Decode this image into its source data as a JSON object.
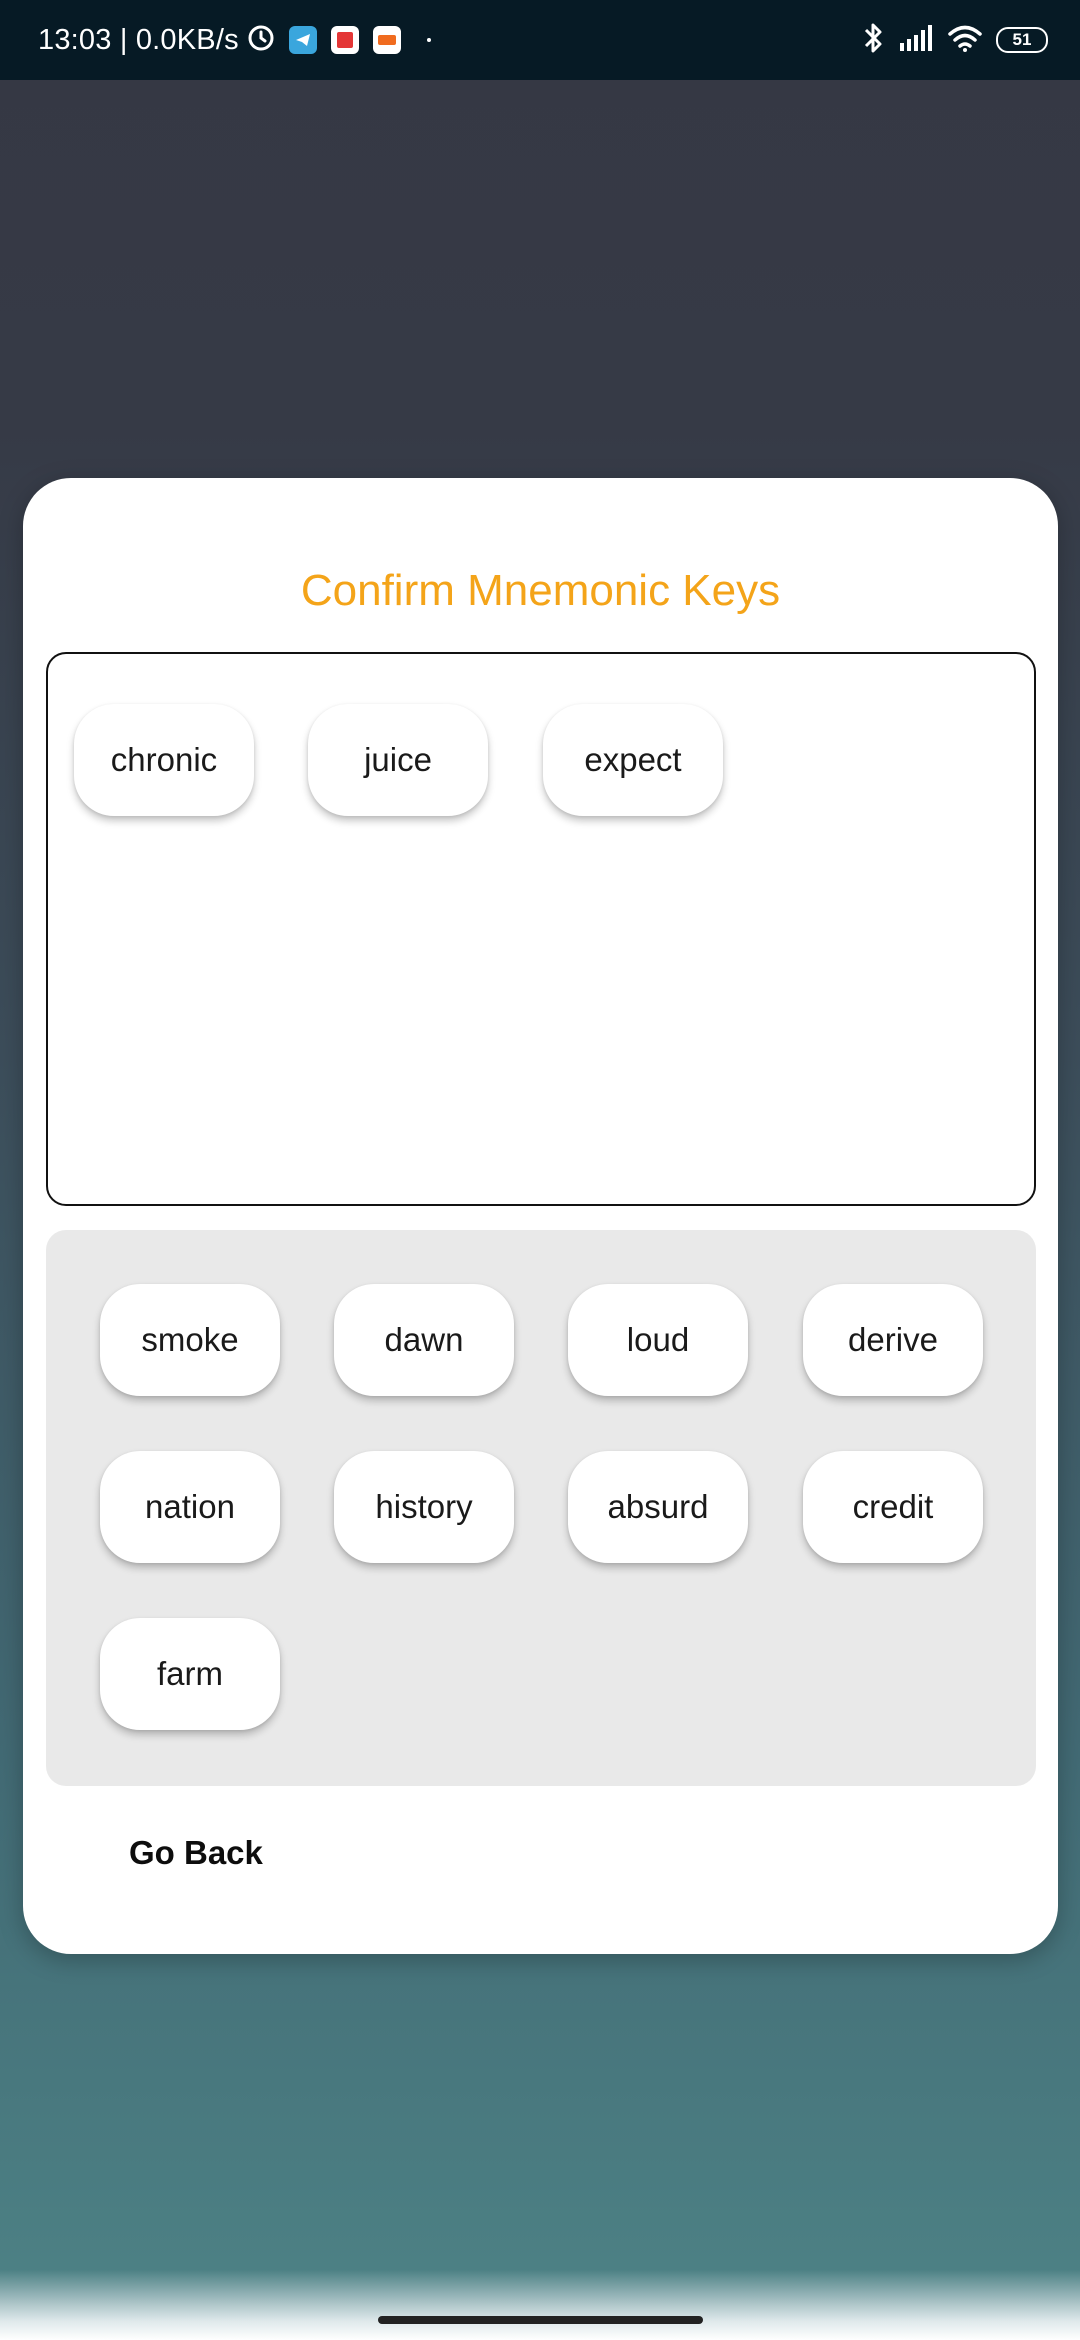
{
  "status_bar": {
    "time_speed": "13:03 | 0.0KB/s",
    "battery": "51",
    "icons": [
      "alarm-icon",
      "telegram-icon",
      "app-icon",
      "shop-icon",
      "bluetooth-icon",
      "signal-icon",
      "wifi-icon",
      "battery-icon"
    ]
  },
  "dialog": {
    "title": "Confirm Mnemonic Keys",
    "title_color": "#f4a419",
    "selected_words": [
      "chronic",
      "juice",
      "expect"
    ],
    "available_words": [
      "smoke",
      "dawn",
      "loud",
      "derive",
      "nation",
      "history",
      "absurd",
      "credit",
      "farm"
    ],
    "go_back_label": "Go Back"
  }
}
